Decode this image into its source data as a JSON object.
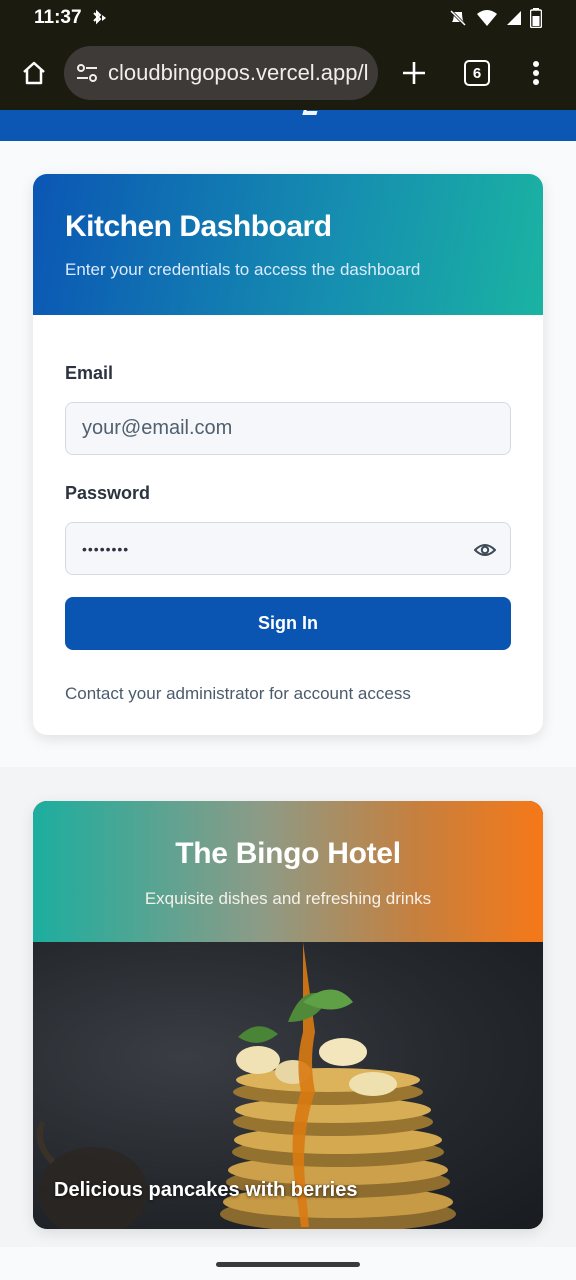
{
  "status_bar": {
    "time": "11:37",
    "icons": [
      "bluetooth-arrow-icon",
      "mute-icon",
      "wifi-icon",
      "signal-icon",
      "battery-icon"
    ]
  },
  "browser": {
    "url": "cloudbingopos.vercel.app/l",
    "tab_count": "6",
    "icons": [
      "home-icon",
      "site-settings-icon",
      "plus-icon",
      "tabs-icon",
      "more-vert-icon"
    ]
  },
  "login": {
    "title": "Kitchen Dashboard",
    "subtitle": "Enter your credentials to access the dashboard",
    "email_label": "Email",
    "email_placeholder": "your@email.com",
    "password_label": "Password",
    "password_value": "••••••••",
    "sign_in_label": "Sign In",
    "contact_text": "Contact your administrator for account access"
  },
  "hotel": {
    "title": "The Bingo Hotel",
    "subtitle": "Exquisite dishes and refreshing drinks",
    "caption": "Delicious pancakes with berries"
  },
  "colors": {
    "primary": "#0b55b2",
    "teal": "#1ab3a2",
    "orange": "#f67818",
    "chrome": "#1c1b10"
  }
}
